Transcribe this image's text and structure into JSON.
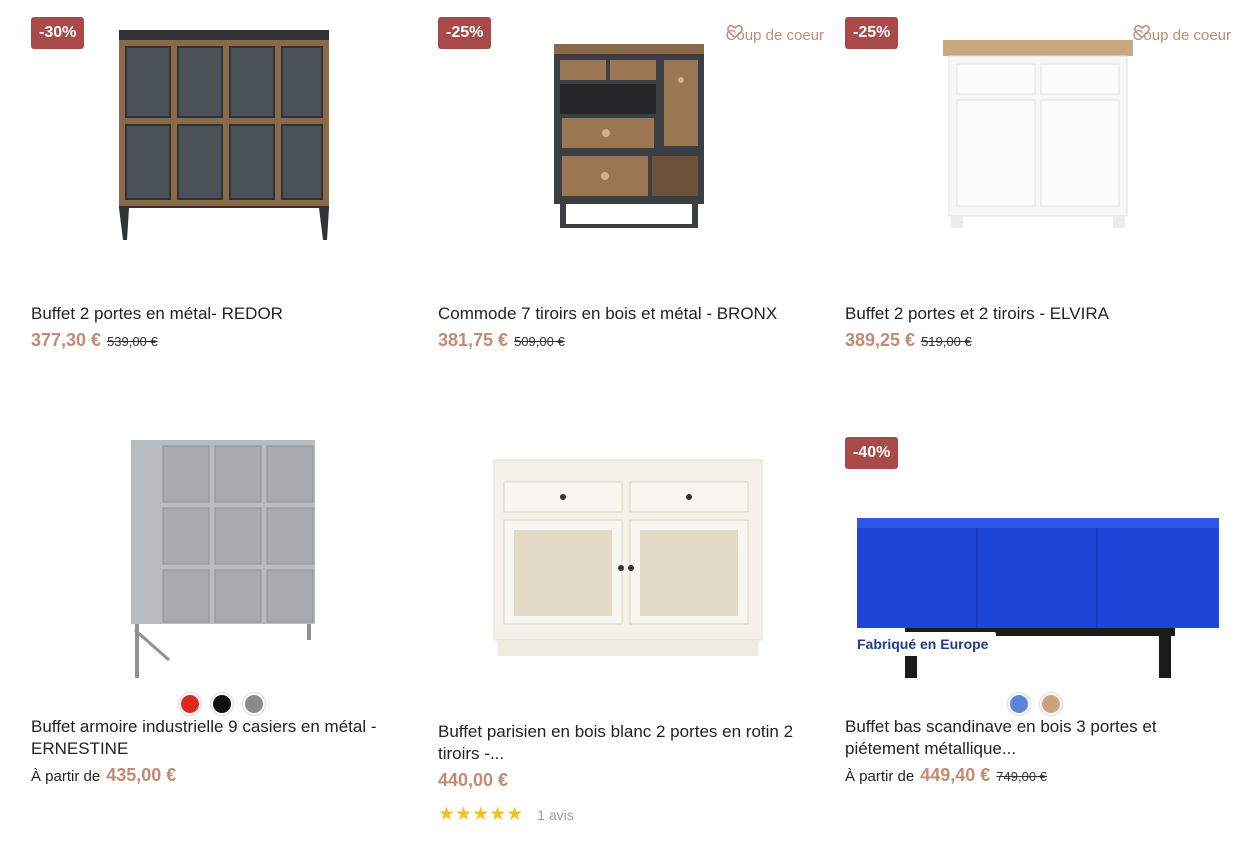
{
  "products": [
    {
      "badge": "-30%",
      "title": "Buffet 2 portes en métal- REDOR",
      "price": "377,30 €",
      "old_price": "539,00 €"
    },
    {
      "badge": "-25%",
      "favorite_label": "Coup de coeur",
      "title": "Commode 7 tiroirs en bois et métal - BRONX",
      "price": "381,75 €",
      "old_price": "509,00 €"
    },
    {
      "badge": "-25%",
      "favorite_label": "Coup de coeur",
      "title": "Buffet 2 portes et 2 tiroirs - ELVIRA",
      "price": "389,25 €",
      "old_price": "519,00 €"
    },
    {
      "title_line1": "Buffet armoire industrielle 9 casiers en métal -",
      "title_line2": "ERNESTINE",
      "price_prefix": "À partir de",
      "price": "435,00 €",
      "swatches": [
        "#e0281e",
        "#111111",
        "#8a8a8a"
      ]
    },
    {
      "title_line1": "Buffet parisien en bois blanc 2 portes en rotin 2",
      "title_line2": "tiroirs -...",
      "price": "440,00 €",
      "stars": "★★★★★",
      "rating": 5,
      "reviews": "1 avis"
    },
    {
      "badge": "-40%",
      "label": "Fabriqué en Europe",
      "title_line1": "Buffet bas scandinave en bois 3 portes et",
      "title_line2": "piétement métallique...",
      "price_prefix": "À partir de",
      "price": "449,40 €",
      "old_price": "749,00 €",
      "swatches": [
        "#5b86d6",
        "#c9a47e"
      ]
    }
  ],
  "colors": {
    "badge": "#a94a4a",
    "price": "#c28b75",
    "favorite": "#c08b76",
    "stars": "#f2c12e",
    "label_text": "#1f3b8f"
  },
  "icons": {
    "favorite": "heart-outline-icon",
    "rating": "star-icon"
  }
}
